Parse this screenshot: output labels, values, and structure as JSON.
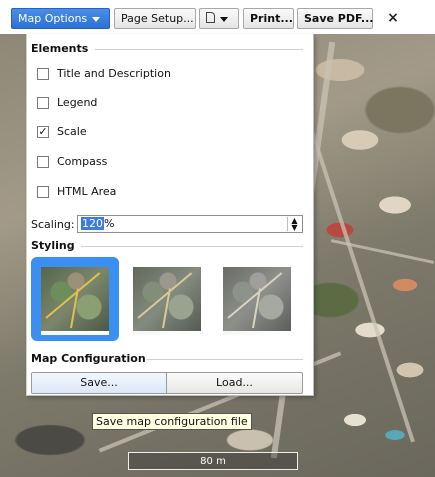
{
  "toolbar": {
    "map_options_label": "Map Options",
    "page_setup_label": "Page Setup...",
    "print_label": "Print...",
    "save_pdf_label": "Save PDF...",
    "close_symbol": "×"
  },
  "panel": {
    "elements_title": "Elements",
    "elements": [
      {
        "label": "Title and Description",
        "checked": false
      },
      {
        "label": "Legend",
        "checked": false
      },
      {
        "label": "Scale",
        "checked": true
      },
      {
        "label": "Compass",
        "checked": false
      },
      {
        "label": "HTML Area",
        "checked": false
      }
    ],
    "scaling_label": "Scaling:",
    "scaling_value": "120",
    "scaling_unit": "%",
    "styling_title": "Styling",
    "styling_selected_index": 0,
    "map_configuration_title": "Map Configuration",
    "save_button_label": "Save...",
    "load_button_label": "Load..."
  },
  "tooltip": "Save map configuration file",
  "scale_bar_label": "80 m",
  "colors": {
    "accent": "#3b8ff0",
    "active_button": "#2c70d6"
  }
}
